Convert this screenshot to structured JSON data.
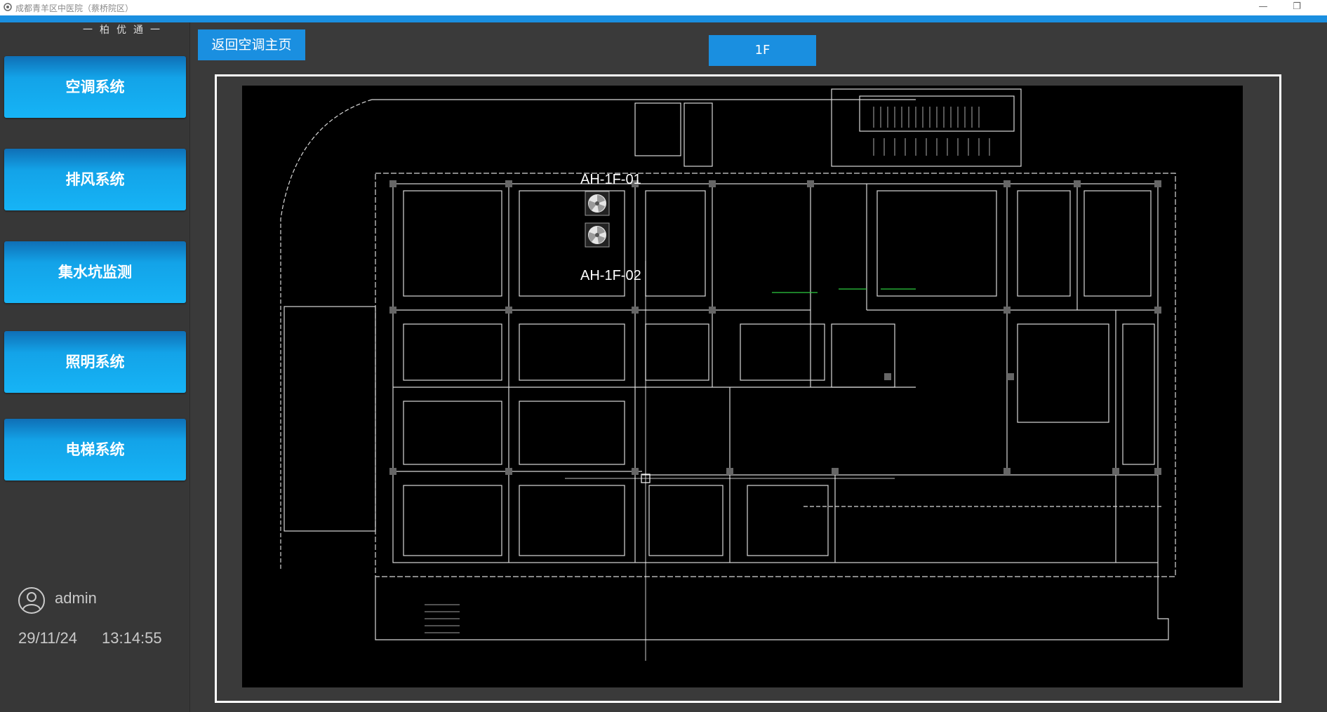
{
  "window": {
    "title": "成都青羊区中医院（蔡桥院区）"
  },
  "sidebar": {
    "brand": "一柏优通一",
    "nav": [
      {
        "label": "空调系统"
      },
      {
        "label": "排风系统"
      },
      {
        "label": "集水坑监测"
      },
      {
        "label": "照明系统"
      },
      {
        "label": "电梯系统"
      }
    ],
    "user": {
      "name": "admin",
      "date": "29/11/24",
      "time": "13:14:55"
    }
  },
  "toolbar": {
    "back_label": "返回空调主页",
    "floor_label": "1F"
  },
  "plan": {
    "units": [
      {
        "label": "AH-1F-01"
      },
      {
        "label": "AH-1F-02"
      }
    ]
  },
  "colors": {
    "accent": "#1a8fe0",
    "nav_button": "#16b4f6",
    "background": "#3a3a3a",
    "plan_bg": "#000000",
    "plan_lines": "#d8d8d8"
  }
}
